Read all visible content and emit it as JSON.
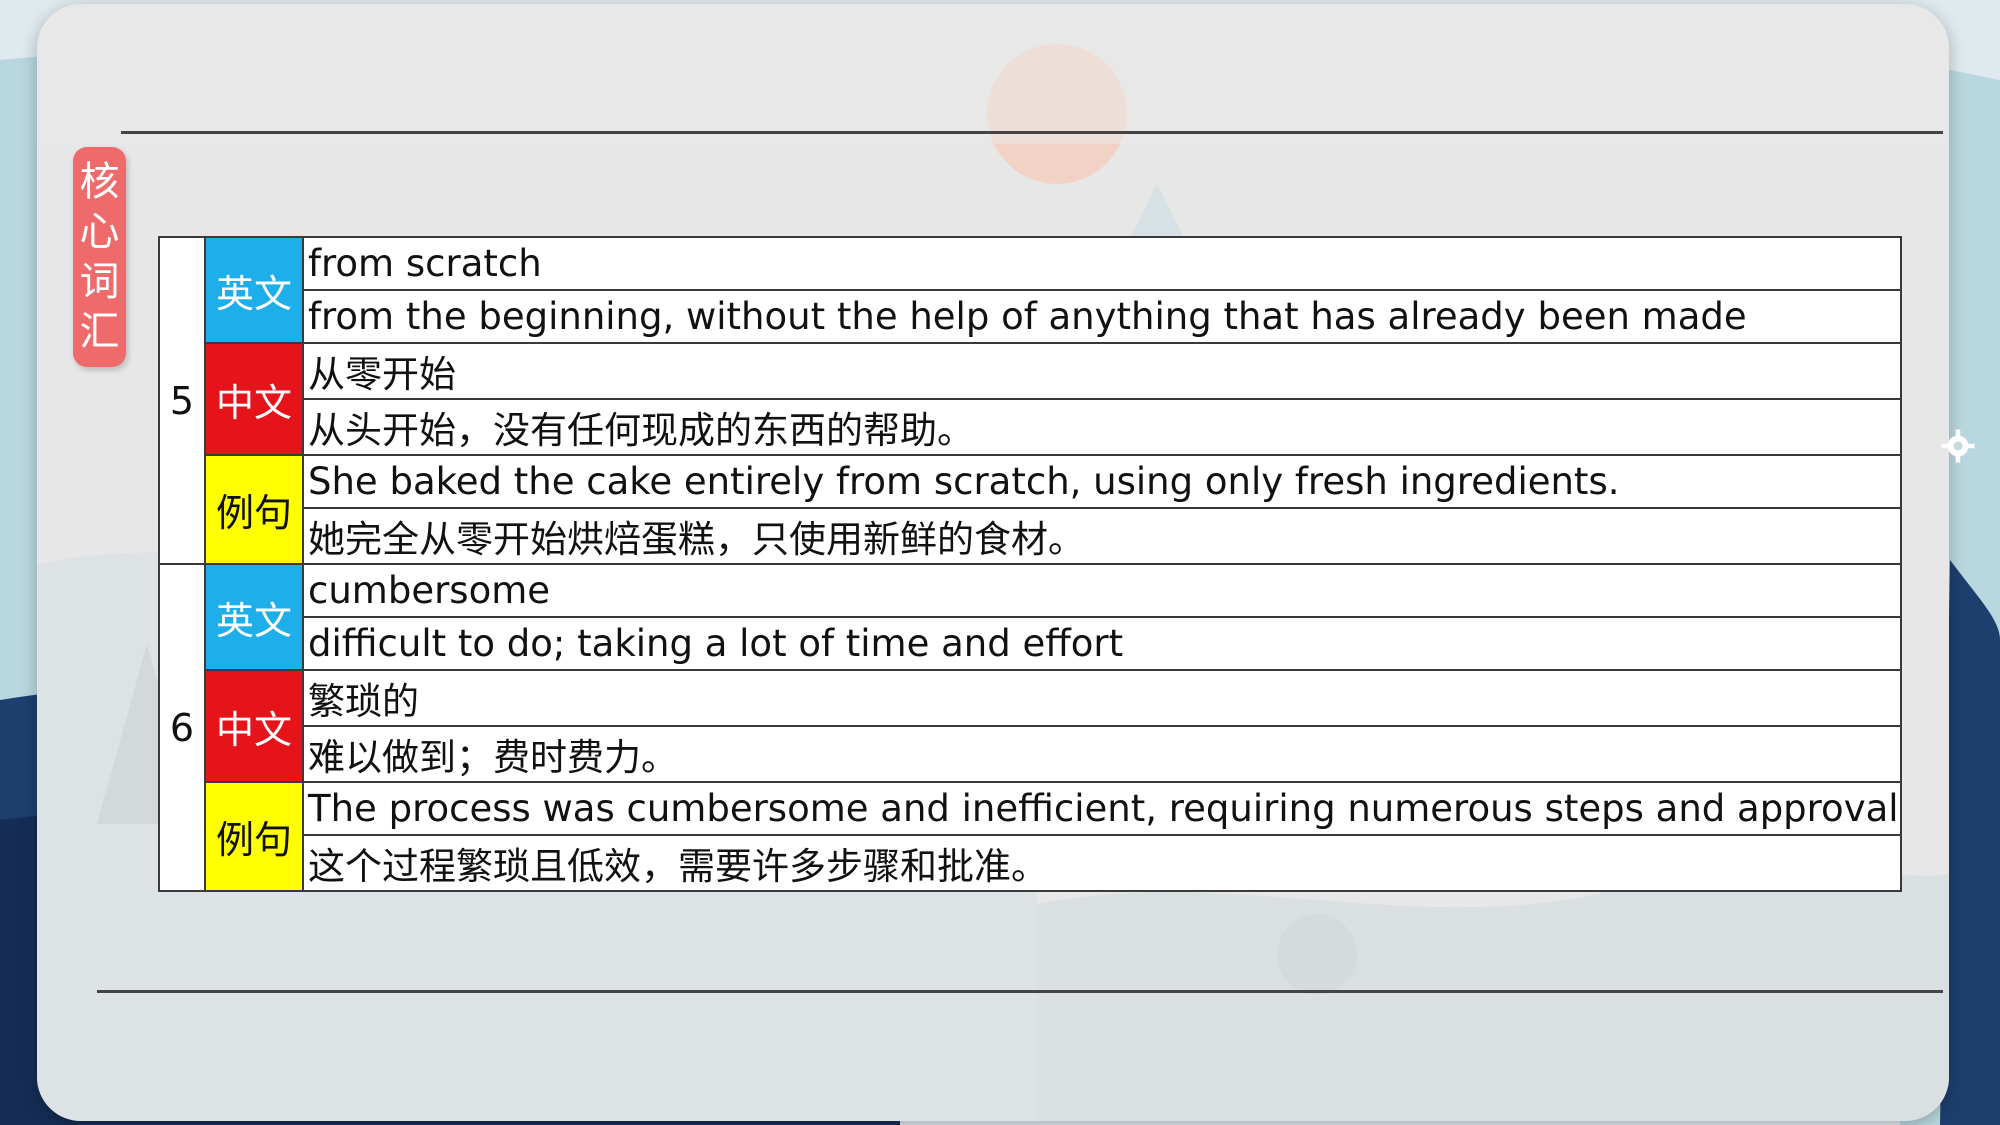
{
  "section_tag": [
    "核",
    "心",
    "词",
    "汇"
  ],
  "colors": {
    "english_tag": "#1eaeea",
    "chinese_tag": "#e6141a",
    "example_tag": "#ffff00",
    "section_tag": "#ef6a6a"
  },
  "entries": [
    {
      "number": "5",
      "english_label": "英文",
      "word": "from scratch",
      "definition": "from the beginning, without the help of anything that has already been made",
      "chinese_label": "中文",
      "chinese_word": "从零开始",
      "chinese_definition": "从头开始，没有任何现成的东西的帮助。",
      "example_label": "例句",
      "example_en": "She baked the cake entirely from scratch, using only fresh ingredients.",
      "example_zh": "她完全从零开始烘焙蛋糕，只使用新鲜的食材。"
    },
    {
      "number": "6",
      "english_label": "英文",
      "word": "cumbersome",
      "definition": "difficult to do; taking a lot of time and effort",
      "chinese_label": "中文",
      "chinese_word": "繁琐的",
      "chinese_definition": "难以做到；费时费力。",
      "example_label": "例句",
      "example_en": "The process was cumbersome and inefficient, requiring numerous steps and approvals.",
      "example_zh": "这个过程繁琐且低效，需要许多步骤和批准。"
    }
  ]
}
